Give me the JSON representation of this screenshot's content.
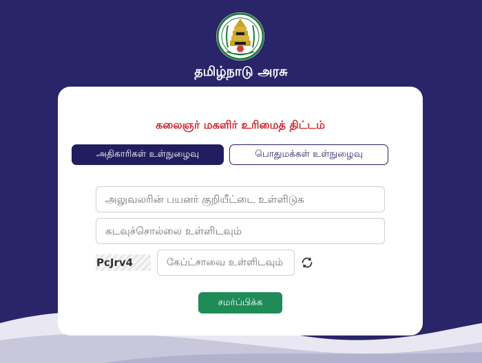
{
  "header": {
    "government_title": "தமிழ்நாடு அரசு",
    "emblem_icon": "tamil-nadu-emblem-icon"
  },
  "form": {
    "scheme_title": "கலைஞர் மகளிர் உரிமைத் திட்டம்",
    "tabs": [
      {
        "label": "அதிகாரிகள் உள்நுழைவு",
        "selected": true
      },
      {
        "label": "பொதுமக்கள் உள்நுழைவு",
        "selected": false
      }
    ],
    "username_placeholder": "அலுவலரின் பயனர் குறியீட்டை உள்ளிடுக",
    "password_placeholder": "கடவுச்சொல்லை உள்ளிடவும்",
    "captcha_code": "PcJrv4",
    "captcha_placeholder": "கேப்ட்சாவை உள்ளிடவும்",
    "refresh_icon": "refresh-icon",
    "submit_label": "சமர்ப்பிக்க"
  },
  "colors": {
    "background": "#2a2468",
    "accent_dark": "#221d5e",
    "title_red": "#d1232a",
    "submit_green": "#1f8b56"
  }
}
